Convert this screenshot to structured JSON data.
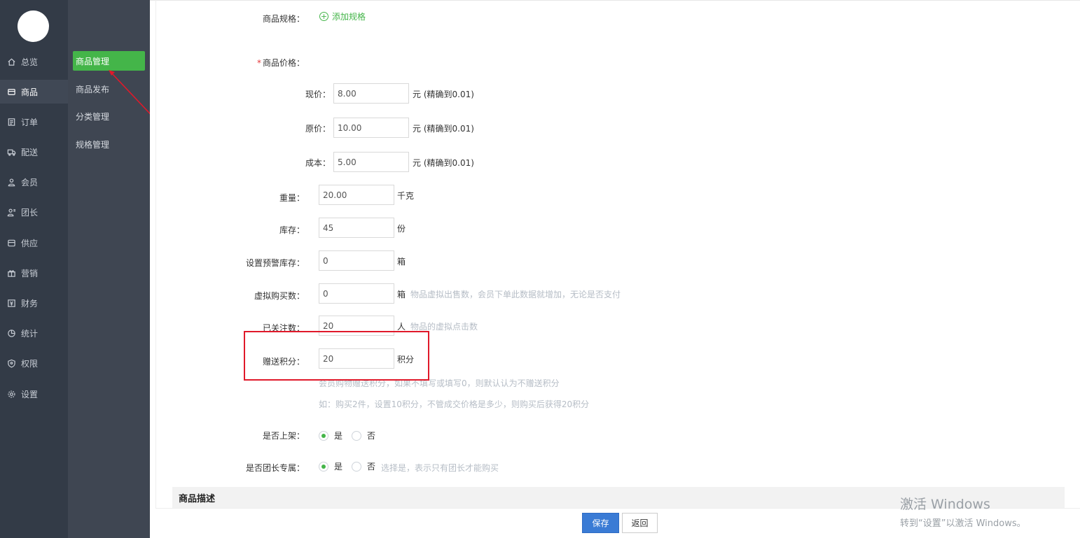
{
  "nav": {
    "items": [
      {
        "label": "总览",
        "icon": "home-icon"
      },
      {
        "label": "商品",
        "icon": "goods-icon"
      },
      {
        "label": "订单",
        "icon": "order-icon"
      },
      {
        "label": "配送",
        "icon": "delivery-icon"
      },
      {
        "label": "会员",
        "icon": "member-icon"
      },
      {
        "label": "团长",
        "icon": "leader-icon"
      },
      {
        "label": "供应",
        "icon": "supply-icon"
      },
      {
        "label": "营销",
        "icon": "gift-icon"
      },
      {
        "label": "财务",
        "icon": "finance-icon"
      },
      {
        "label": "统计",
        "icon": "chart-pie-icon"
      },
      {
        "label": "权限",
        "icon": "shield-icon"
      },
      {
        "label": "设置",
        "icon": "gear-icon"
      }
    ]
  },
  "subnav": {
    "items": [
      {
        "label": "商品管理"
      },
      {
        "label": "商品发布"
      },
      {
        "label": "分类管理"
      },
      {
        "label": "规格管理"
      }
    ]
  },
  "form": {
    "spec_label": "商品规格：",
    "add_spec": "添加规格",
    "price_label": "商品价格：",
    "price_required": "*",
    "current_price": {
      "label": "现价：",
      "value": "8.00",
      "unit": "元 (精确到0.01)"
    },
    "original_price": {
      "label": "原价：",
      "value": "10.00",
      "unit": "元 (精确到0.01)"
    },
    "cost": {
      "label": "成本：",
      "value": "5.00",
      "unit": "元 (精确到0.01)"
    },
    "weight": {
      "label": "重量：",
      "value": "20.00",
      "unit": "千克"
    },
    "stock": {
      "label": "库存：",
      "value": "45",
      "unit": "份"
    },
    "warn_stock": {
      "label": "设置预警库存：",
      "value": "0",
      "unit": "箱"
    },
    "virtual_buy": {
      "label": "虚拟购买数：",
      "value": "0",
      "unit": "箱",
      "hint": "物品虚拟出售数，会员下单此数据就增加，无论是否支付"
    },
    "followers": {
      "label": "已关注数：",
      "value": "20",
      "unit": "人",
      "hint": "物品的虚拟点击数"
    },
    "points": {
      "label": "赠送积分：",
      "value": "20",
      "unit": "积分",
      "hint1": "会员购物赠送积分，如果不填写或填写0，则默认认为不赠送积分",
      "hint2": "如：购买2件，设置10积分，不管成交价格是多少，则购买后获得20积分"
    },
    "on_shelf": {
      "label": "是否上架：",
      "yes": "是",
      "no": "否"
    },
    "leader_only": {
      "label": "是否团长专属：",
      "yes": "是",
      "no": "否",
      "hint": "选择是，表示只有团长才能购买"
    }
  },
  "section": {
    "description_title": "商品描述"
  },
  "footer": {
    "save": "保存",
    "back": "返回"
  },
  "watermark": {
    "line1": "激活 Windows",
    "line2": "转到“设置”以激活 Windows。"
  },
  "colors": {
    "accent": "#44b549",
    "primary_button": "#3a7bd5",
    "annotation": "#e0192a"
  }
}
